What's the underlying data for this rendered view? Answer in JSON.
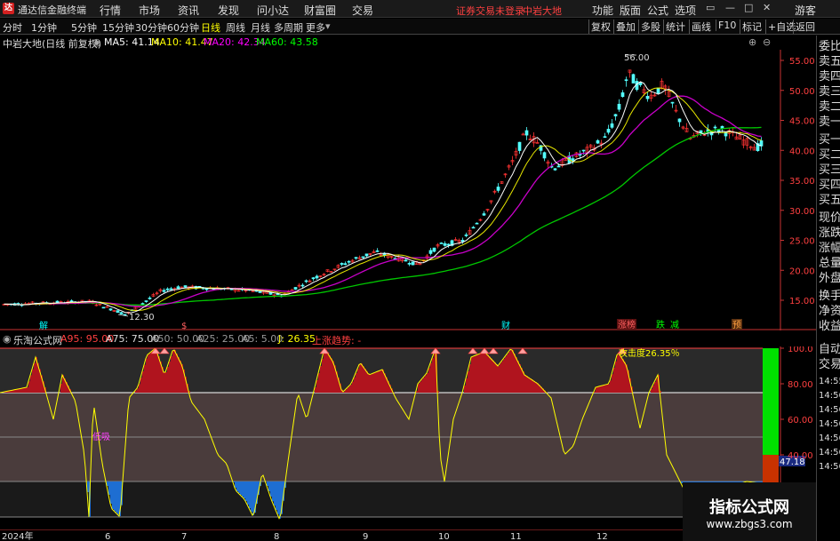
{
  "titlebar": {
    "logo": "达",
    "app_title": "通达信金融终端",
    "menus": [
      "行情",
      "市场",
      "资讯",
      "发现",
      "问小达",
      "财富圈",
      "交易"
    ],
    "login_warning": "证券交易未登录",
    "stock_name": "中岩大地",
    "right_menus": [
      "功能",
      "版面",
      "公式",
      "选项"
    ],
    "user": "游客"
  },
  "periods": [
    "分时",
    "1分钟",
    "5分钟",
    "15分钟",
    "30分钟",
    "60分钟",
    "日线",
    "周线",
    "月线",
    "多周期",
    "更多"
  ],
  "active_period": "日线",
  "tools": [
    "复权",
    "叠加",
    "多股",
    "统计",
    "画线",
    "F10",
    "标记",
    "+自选",
    "返回"
  ],
  "info": {
    "stock": "中岩大地(日线 前复权)",
    "ma5": "MA5: 41.14",
    "ma10": "MA10: 41.47",
    "ma20": "MA20: 42.34",
    "ma60": "MA60: 43.58"
  },
  "colors": {
    "ma5": "#ffffff",
    "ma10": "#ffff00",
    "ma20": "#ff00ff",
    "ma60": "#00ff00",
    "up": "#ff3232",
    "down": "#54ffff",
    "axis": "#c83232",
    "indicator_fill_top": "#b0141e",
    "indicator_fill_mid": "#4a3c3c",
    "indicator_line": "#ffff00",
    "indicator_low_fill": "#1e6ed2"
  },
  "price_axis": [
    "55.00",
    "50.00",
    "45.00",
    "40.00",
    "35.00",
    "30.00",
    "25.00",
    "20.00",
    "15.00"
  ],
  "price_annotations": {
    "high": "56.00",
    "low": "12.30"
  },
  "event_markers": [
    "解",
    "$",
    "财",
    "涨榜",
    "跌",
    "减",
    "预"
  ],
  "right_panel": [
    "委比",
    "卖五",
    "卖四",
    "卖三",
    "卖二",
    "卖一",
    "买一",
    "买二",
    "买三",
    "买四",
    "买五",
    "现价",
    "涨跌",
    "涨幅",
    "总量",
    "外盘",
    "换手",
    "净资",
    "收益",
    "自动",
    "交易"
  ],
  "right_panel_times": [
    "14:55",
    "14:56",
    "14:56",
    "14:56",
    "14:56",
    "14:56",
    "14:56"
  ],
  "indicator": {
    "name": "乐淘公式网",
    "a95": "A95: 95.00",
    "a75": "A75: 75.00",
    "a50": "A50: 50.00",
    "a25": "A25: 25.00",
    "a5": "A5: 5.00",
    "j": "J: 26.35",
    "trend": "上涨趋势: -",
    "attack_label": "攻击度26.35％",
    "low_label": "低吸",
    "axis": [
      "100.0",
      "80.00",
      "60.00",
      "40.00"
    ],
    "bar_value": "47.18"
  },
  "x_axis": [
    "2024年",
    "6",
    "7",
    "8",
    "9",
    "10",
    "11",
    "12"
  ],
  "watermark": {
    "line1": "指标公式网",
    "line2": "www.zbgs3.com"
  },
  "chart_data": {
    "type": "candlestick",
    "price_range": [
      12.3,
      56.0
    ],
    "moving_averages": {
      "MA5": 41.14,
      "MA10": 41.47,
      "MA20": 42.34,
      "MA60": 43.58
    }
  }
}
